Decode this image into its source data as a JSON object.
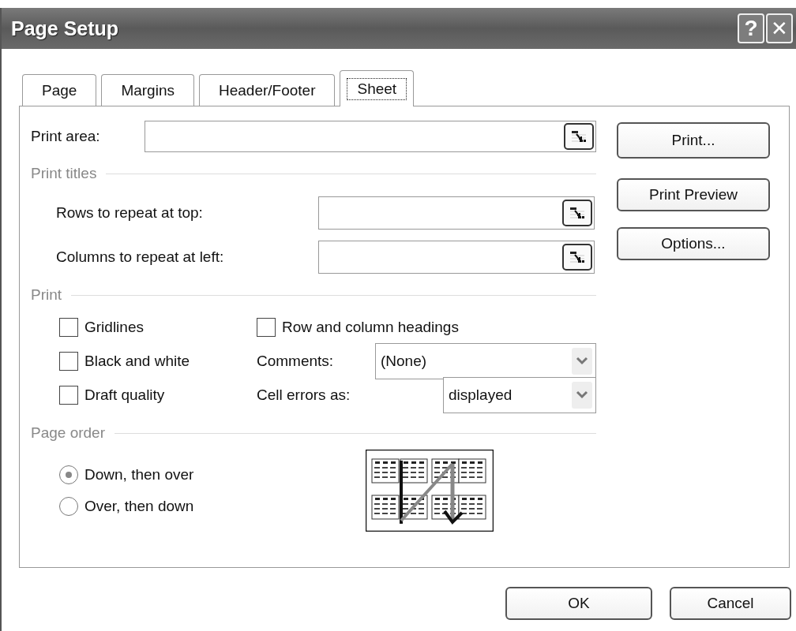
{
  "window": {
    "title": "Page Setup",
    "title_buttons": [
      {
        "kind": "help",
        "label": "?"
      },
      {
        "kind": "close",
        "label": "✕"
      }
    ]
  },
  "tabs": [
    {
      "label": "Page",
      "selected": false
    },
    {
      "label": "Margins",
      "selected": false
    },
    {
      "label": "Header/Footer",
      "selected": false
    },
    {
      "label": "Sheet",
      "selected": true
    }
  ],
  "print_area": {
    "label": "Print area:"
  },
  "print_titles": {
    "heading": "Print titles",
    "fields": [
      {
        "label": "Rows to repeat at top:"
      },
      {
        "label": "Columns to repeat at left:"
      }
    ]
  },
  "print": {
    "heading": "Print",
    "checkboxes": [
      {
        "label": "Gridlines",
        "checked": false
      },
      {
        "label": "Black and white",
        "checked": false
      },
      {
        "label": "Draft quality",
        "checked": false
      },
      {
        "label": "Row and column headings",
        "checked": false
      }
    ],
    "dropdowns": [
      {
        "label": "Comments:",
        "value": "(None)"
      },
      {
        "label": "Cell errors as:",
        "value": "displayed"
      }
    ]
  },
  "page_order": {
    "heading": "Page order",
    "options": [
      {
        "label": "Down, then over",
        "selected": true
      },
      {
        "label": "Over, then down",
        "selected": false
      }
    ]
  },
  "side_buttons": [
    "Print...",
    "Print Preview",
    "Options..."
  ],
  "footer_buttons": [
    "OK",
    "Cancel"
  ]
}
